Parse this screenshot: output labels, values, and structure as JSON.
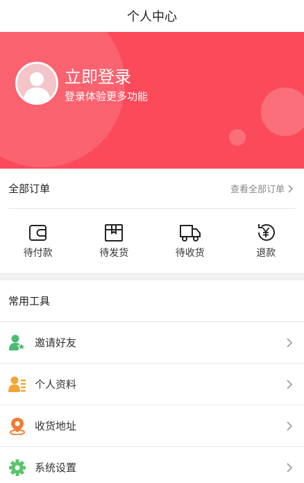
{
  "navbar": {
    "title": "个人中心"
  },
  "profile": {
    "title": "立即登录",
    "subtitle": "登录体验更多功能",
    "accent_color": "#fb4b5a"
  },
  "orders": {
    "title": "全部订单",
    "view_all": "查看全部订单",
    "items": [
      {
        "label": "待付款",
        "icon": "wallet-icon"
      },
      {
        "label": "待发货",
        "icon": "package-box-icon"
      },
      {
        "label": "待收货",
        "icon": "delivery-truck-icon"
      },
      {
        "label": "退款",
        "icon": "yen-refund-icon"
      }
    ]
  },
  "tools": {
    "title": "常用工具",
    "items": [
      {
        "label": "邀请好友",
        "icon": "invite-user-icon",
        "color": "#4cba73"
      },
      {
        "label": "个人资料",
        "icon": "profile-card-icon",
        "color": "#f2a535"
      },
      {
        "label": "收货地址",
        "icon": "location-pin-icon",
        "color": "#f57a2e"
      },
      {
        "label": "系统设置",
        "icon": "gear-icon",
        "color": "#5bc36a"
      }
    ]
  }
}
